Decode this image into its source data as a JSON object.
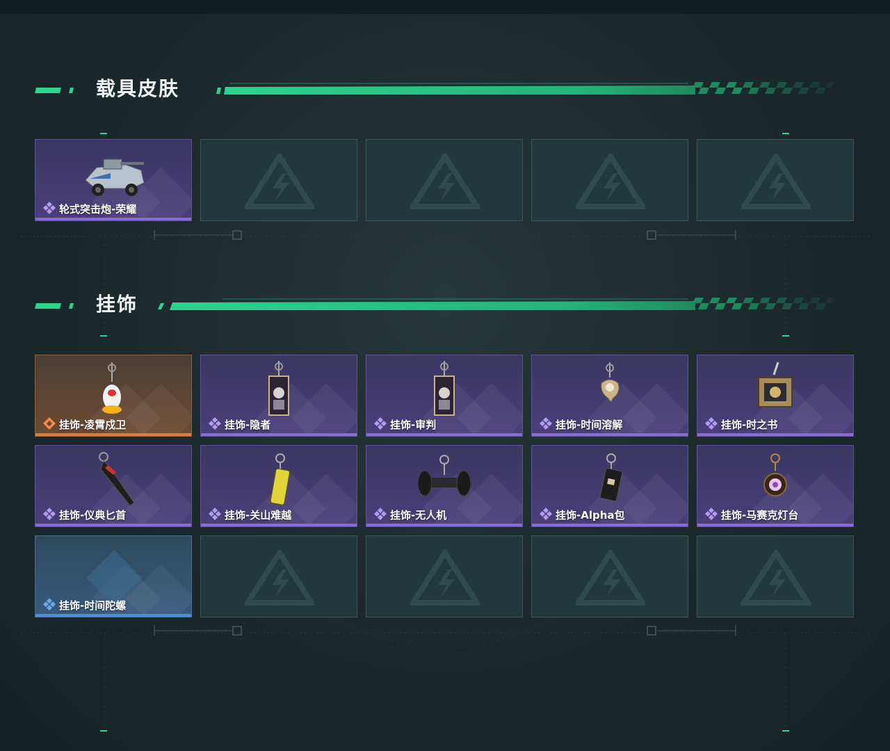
{
  "sections": [
    {
      "title": "载具皮肤",
      "items": [
        {
          "label": "轮式突击炮-荣耀",
          "rarity": "purple",
          "icon": "armored-car-icon"
        },
        {
          "label": "",
          "rarity": "empty",
          "icon": "placeholder-logo-icon"
        },
        {
          "label": "",
          "rarity": "empty",
          "icon": "placeholder-logo-icon"
        },
        {
          "label": "",
          "rarity": "empty",
          "icon": "placeholder-logo-icon"
        },
        {
          "label": "",
          "rarity": "empty",
          "icon": "placeholder-logo-icon"
        }
      ]
    },
    {
      "title": "挂饰",
      "items": [
        {
          "label": "挂饰-凌霄戍卫",
          "rarity": "orange",
          "icon": "charm-penguin-icon"
        },
        {
          "label": "挂饰-隐者",
          "rarity": "purple",
          "icon": "charm-tarot-card-icon"
        },
        {
          "label": "挂饰-审判",
          "rarity": "purple",
          "icon": "charm-tarot-card-icon"
        },
        {
          "label": "挂饰-时间溶解",
          "rarity": "purple",
          "icon": "charm-melting-clock-icon"
        },
        {
          "label": "挂饰-时之书",
          "rarity": "purple",
          "icon": "charm-book-icon"
        },
        {
          "label": "挂饰-仪典匕首",
          "rarity": "purple",
          "icon": "charm-dagger-icon"
        },
        {
          "label": "挂饰-关山难越",
          "rarity": "purple",
          "icon": "charm-canister-icon"
        },
        {
          "label": "挂饰-无人机",
          "rarity": "purple",
          "icon": "charm-drone-icon"
        },
        {
          "label": "挂饰-Alpha包",
          "rarity": "purple",
          "icon": "charm-pouch-icon"
        },
        {
          "label": "挂饰-马赛克灯台",
          "rarity": "purple",
          "icon": "charm-mosaic-lamp-icon"
        },
        {
          "label": "挂饰-时间陀螺",
          "rarity": "blue",
          "icon": "charm-gyro-icon"
        },
        {
          "label": "",
          "rarity": "empty",
          "icon": "placeholder-logo-icon"
        },
        {
          "label": "",
          "rarity": "empty",
          "icon": "placeholder-logo-icon"
        },
        {
          "label": "",
          "rarity": "empty",
          "icon": "placeholder-logo-icon"
        },
        {
          "label": "",
          "rarity": "empty",
          "icon": "placeholder-logo-icon"
        }
      ]
    }
  ],
  "colors": {
    "accent_green": "#2bd48f",
    "rarity_purple": "#8a6ad9",
    "rarity_orange": "#e27a3a",
    "rarity_blue": "#4f8fd6"
  }
}
